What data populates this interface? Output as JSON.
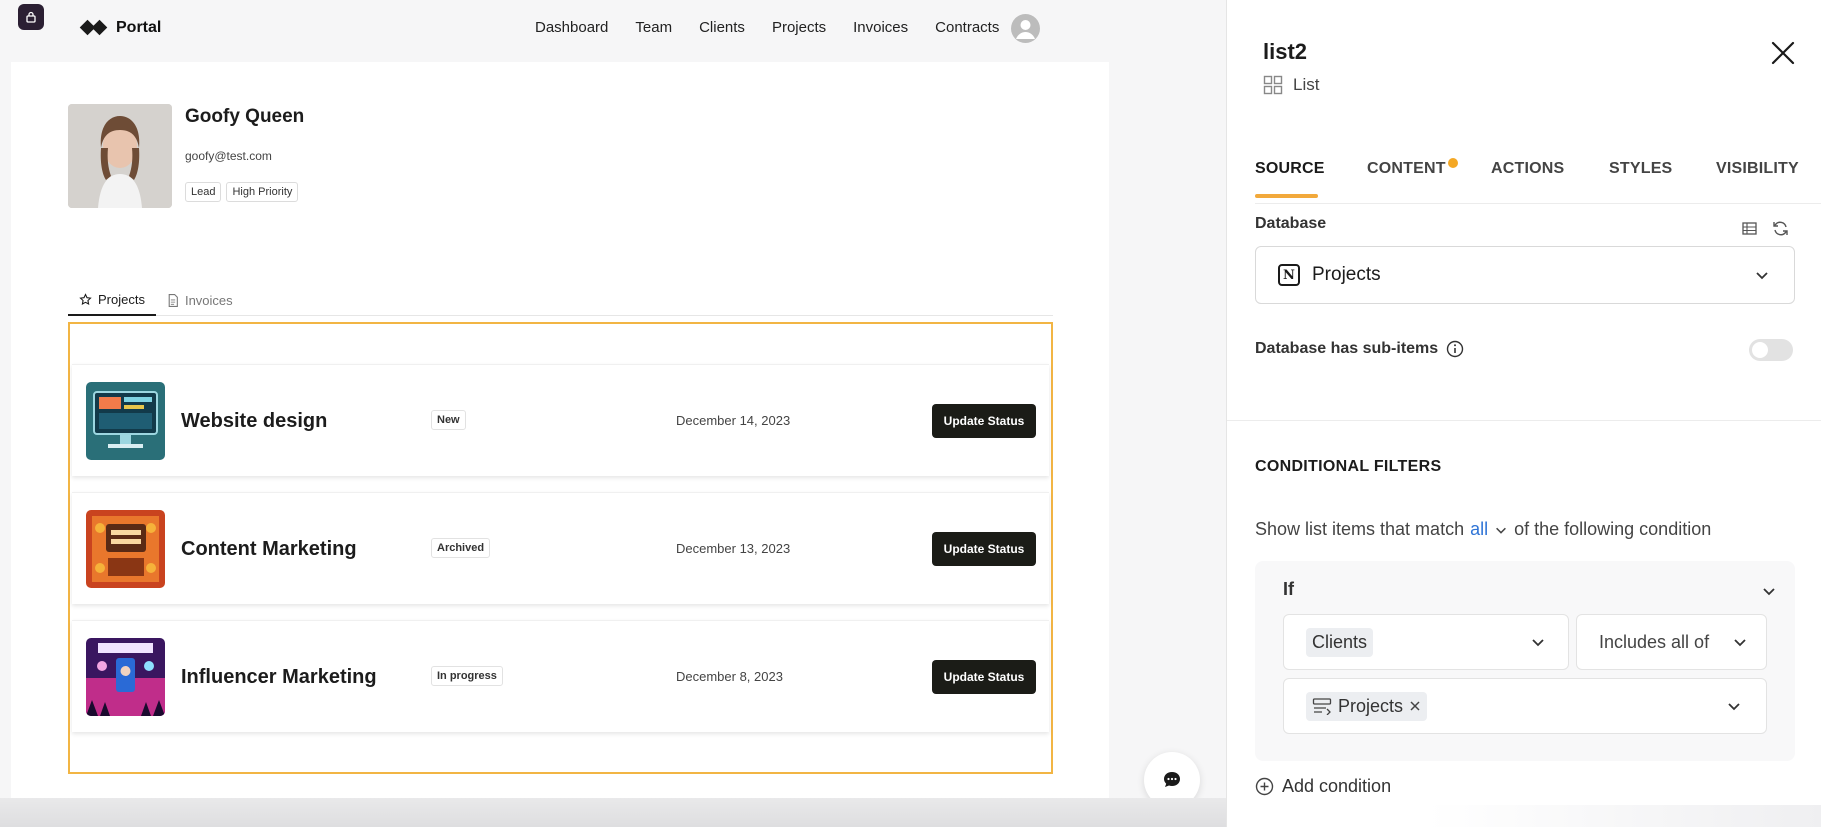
{
  "nav": {
    "brand": "Portal",
    "links": [
      "Dashboard",
      "Team",
      "Clients",
      "Projects",
      "Invoices",
      "Contracts"
    ]
  },
  "profile": {
    "name": "Goofy Queen",
    "email": "goofy@test.com",
    "tags": [
      "Lead",
      "High Priority"
    ]
  },
  "tabs": [
    "Projects",
    "Invoices"
  ],
  "projects": [
    {
      "title": "Website design",
      "status": "New",
      "date": "December 14, 2023",
      "button": "Update Status"
    },
    {
      "title": "Content Marketing",
      "status": "Archived",
      "date": "December 13, 2023",
      "button": "Update Status"
    },
    {
      "title": "Influencer Marketing",
      "status": "In progress",
      "date": "December 8, 2023",
      "button": "Update Status"
    }
  ],
  "panel": {
    "title": "list2",
    "subtitle": "List",
    "tabs": [
      "SOURCE",
      "CONTENT",
      "ACTIONS",
      "STYLES",
      "VISIBILITY"
    ],
    "database_label": "Database",
    "database_value": "Projects",
    "subitems_label": "Database has sub-items",
    "conditional_title": "CONDITIONAL FILTERS",
    "match_prefix": "Show list items that match",
    "match_value": "all",
    "match_suffix": "of the following condition",
    "if_label": "If",
    "condition_field": "Clients",
    "condition_operator": "Includes all of",
    "condition_value": "Projects",
    "add_condition": "Add condition"
  },
  "colors": {
    "accent": "#f2b544",
    "tab_underline": "#f2a93b",
    "link_blue": "#2f74d6",
    "button_dark": "#1b1c17"
  }
}
